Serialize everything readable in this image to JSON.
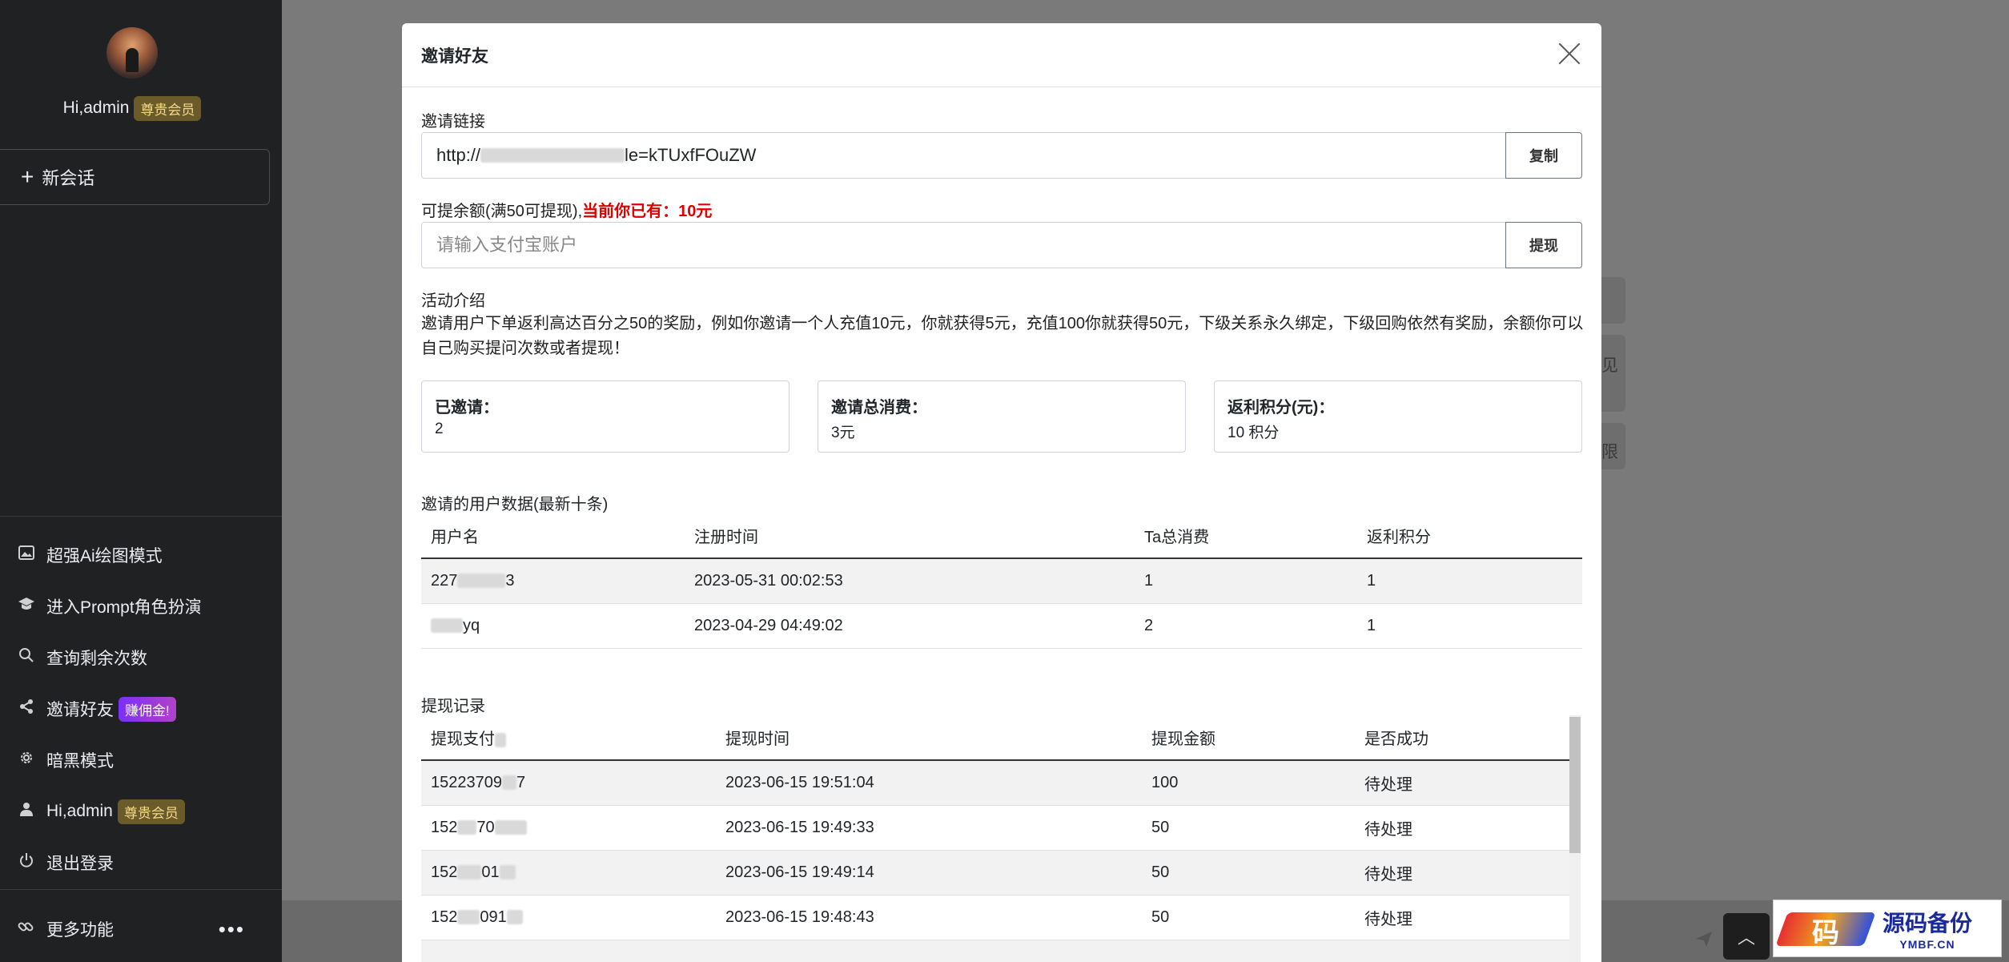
{
  "sidebar": {
    "greeting": "Hi,admin",
    "member_badge": "尊贵会员",
    "new_chat": "新会话",
    "menu": [
      {
        "icon": "image-icon",
        "label": "超强Ai绘图模式",
        "badge": ""
      },
      {
        "icon": "graduation-cap-icon",
        "label": "进入Prompt角色扮演",
        "badge": ""
      },
      {
        "icon": "search-icon",
        "label": "查询剩余次数",
        "badge": ""
      },
      {
        "icon": "share-icon",
        "label": "邀请好友",
        "badge": "赚佣金!"
      },
      {
        "icon": "gear-icon",
        "label": "暗黑模式",
        "badge": ""
      },
      {
        "icon": "user-icon",
        "label": "Hi,admin",
        "badge": "尊贵会员"
      },
      {
        "icon": "power-icon",
        "label": "退出登录",
        "badge": ""
      }
    ],
    "more": "更多功能"
  },
  "background": {
    "hint1": "见",
    "hint2": "限"
  },
  "watermark": {
    "title": "源码备份",
    "url": "YMBF.CN",
    "glyph": "码"
  },
  "modal": {
    "title": "邀请好友",
    "invite_label": "邀请链接",
    "invite_link_prefix": "http://",
    "invite_link_suffix": "le=kTUxfFOuZW",
    "copy_button": "复制",
    "balance_label": "可提余额(满50可提现),",
    "balance_current": "当前你已有：10元",
    "alipay_placeholder": "请输入支付宝账户",
    "withdraw_button": "提现",
    "intro_title": "活动介绍",
    "intro_text": "邀请用户下单返利高达百分之50的奖励，例如你邀请一个人充值10元，你就获得5元，充值100你就获得50元，下级关系永久绑定，下级回购依然有奖励，余额你可以自己购买提问次数或者提现！",
    "stats": [
      {
        "label": "已邀请：",
        "value": "2"
      },
      {
        "label": "邀请总消费：",
        "value": "3元"
      },
      {
        "label": "返利积分(元)：",
        "value": "10 积分"
      }
    ],
    "users_table": {
      "title": "邀请的用户数据(最新十条)",
      "headers": [
        "用户名",
        "注册时间",
        "Ta总消费",
        "返利积分"
      ],
      "rows": [
        {
          "user": "227",
          "user_tail": "3",
          "time": "2023-05-31 00:02:53",
          "spend": "1",
          "points": "1"
        },
        {
          "user": "",
          "user_tail": "yq",
          "time": "2023-04-29 04:49:02",
          "spend": "2",
          "points": "1"
        }
      ]
    },
    "withdraw_table": {
      "title": "提现记录",
      "headers": [
        "提现支付",
        "提现时间",
        "提现金额",
        "是否成功"
      ],
      "rows": [
        {
          "account": "15223709",
          "tail": "7",
          "time": "2023-06-15 19:51:04",
          "amount": "100",
          "status": "待处理"
        },
        {
          "account": "152",
          "tail": "70",
          "time": "2023-06-15 19:49:33",
          "amount": "50",
          "status": "待处理"
        },
        {
          "account": "152",
          "tail": "01",
          "time": "2023-06-15 19:49:14",
          "amount": "50",
          "status": "待处理"
        },
        {
          "account": "152",
          "tail": "091",
          "time": "2023-06-15 19:48:43",
          "amount": "50",
          "status": "待处理"
        }
      ]
    }
  }
}
